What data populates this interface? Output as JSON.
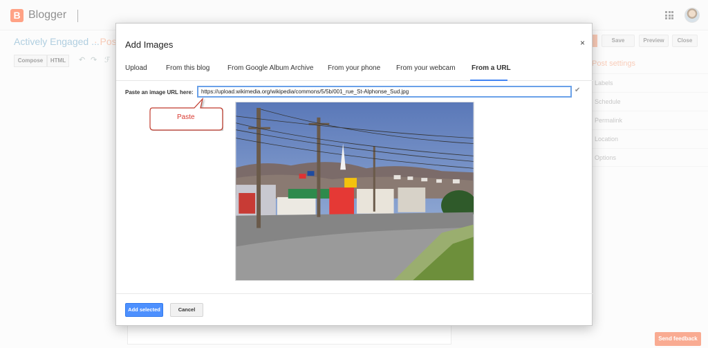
{
  "app": {
    "name": "Blogger",
    "logo_letter": "B",
    "apps_icon": "apps-grid-icon",
    "avatar_icon": "user-avatar"
  },
  "post": {
    "title": "Actively Engaged ...",
    "suffix": "· Post"
  },
  "header_buttons": {
    "save": "Save",
    "preview": "Preview",
    "close": "Close"
  },
  "editor_toolbar": {
    "compose": "Compose",
    "html": "HTML",
    "undo_icon": "↶",
    "redo_icon": "↷",
    "font_icon": "ℱ"
  },
  "post_settings": {
    "heading": "Post settings",
    "items": [
      "Labels",
      "Schedule",
      "Permalink",
      "Location",
      "Options"
    ]
  },
  "modal": {
    "title": "Add Images",
    "close": "×",
    "tabs": [
      "Upload",
      "From this blog",
      "From Google Album Archive",
      "From your phone",
      "From your webcam",
      "From a URL"
    ],
    "active_tab": "From a URL",
    "url_label": "Paste an image URL here:",
    "url_value": "https://upload.wikimedia.org/wikipedia/commons/5/5b/001_rue_St-Alphonse_Sud.jpg",
    "check_icon": "✔",
    "callout_label": "Paste",
    "preview_image": "street-photo",
    "add_button": "Add selected",
    "cancel_button": "Cancel"
  },
  "feedback": "Send feedback",
  "colors": {
    "brand": "#ff5722",
    "primary_button": "#4d90fe",
    "tab_underline": "#4285f4",
    "input_focus": "#6aa1e8",
    "callout_text": "#d8382f",
    "callout_stroke": "#c0392b",
    "feedback": "#f4673a"
  }
}
